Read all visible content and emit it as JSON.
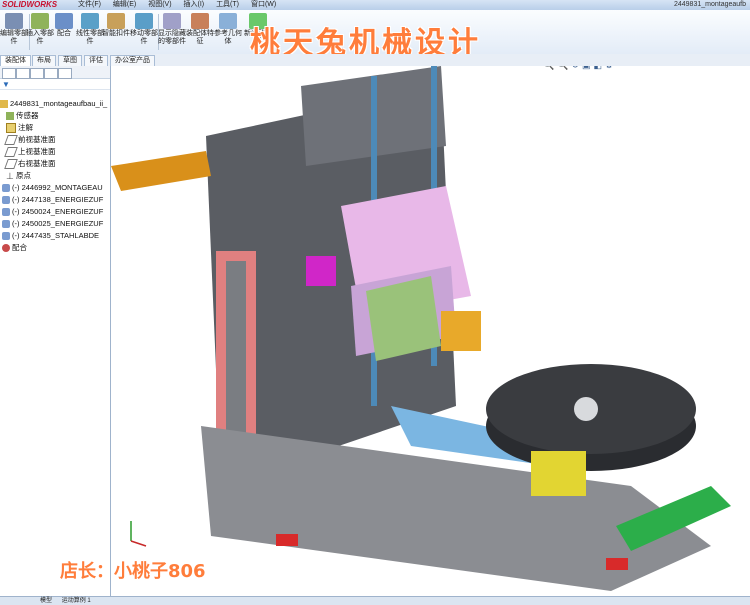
{
  "app": {
    "logo": "SOLIDWORKS",
    "document_title": "2449831_montageaufb"
  },
  "menu": [
    "文件(F)",
    "编辑(E)",
    "视图(V)",
    "插入(I)",
    "工具(T)",
    "窗口(W)"
  ],
  "commands": [
    {
      "label": "编辑零部件",
      "color": "#7a8fb3"
    },
    {
      "label": "插入零部件",
      "color": "#8fb35a"
    },
    {
      "label": "配合",
      "color": "#6b8fc8"
    },
    {
      "label": "线性零部件",
      "color": "#5aa0c8"
    },
    {
      "label": "智能扣件",
      "color": "#c8a05a"
    },
    {
      "label": "移动零部件",
      "color": "#5a9ec8"
    },
    {
      "label": "显示隐藏的零部件",
      "color": "#a0a0c8"
    },
    {
      "label": "装配体特征",
      "color": "#c8805a"
    },
    {
      "label": "参考几何体",
      "color": "#8ab0d8"
    },
    {
      "label": "新运动算例",
      "color": "#6ac86a"
    }
  ],
  "tabs": [
    "装配体",
    "布局",
    "草图",
    "评估",
    "办公室产品"
  ],
  "tree": {
    "root": "2449831_montageaufbau_ii_",
    "items": [
      {
        "label": "传感器",
        "icon": "sensor-icon"
      },
      {
        "label": "注解",
        "icon": "annotation-icon"
      },
      {
        "label": "前视基准面",
        "icon": "plane-icon"
      },
      {
        "label": "上视基准面",
        "icon": "plane-icon"
      },
      {
        "label": "右视基准面",
        "icon": "plane-icon"
      },
      {
        "label": "原点",
        "icon": "origin-icon"
      },
      {
        "label": "(-) 2446992_MONTAGEAU",
        "icon": "component-icon"
      },
      {
        "label": "(-) 2447138_ENERGIEZUF",
        "icon": "component-icon"
      },
      {
        "label": "(-) 2450024_ENERGIEZUF",
        "icon": "component-icon"
      },
      {
        "label": "(-) 2450025_ENERGIEZUF",
        "icon": "component-icon"
      },
      {
        "label": "(-) 2447435_STAHLABDE",
        "icon": "component-icon"
      },
      {
        "label": "配合",
        "icon": "mates-icon"
      }
    ]
  },
  "watermark": {
    "title": "桃天兔机械设计",
    "owner": "店长：小桃子806"
  },
  "statusbar": {
    "tab1": "模型",
    "tab2": "运动算例 1"
  },
  "colors": {
    "accent": "#ff7d3b",
    "viewport_bg": "#ffffff"
  }
}
